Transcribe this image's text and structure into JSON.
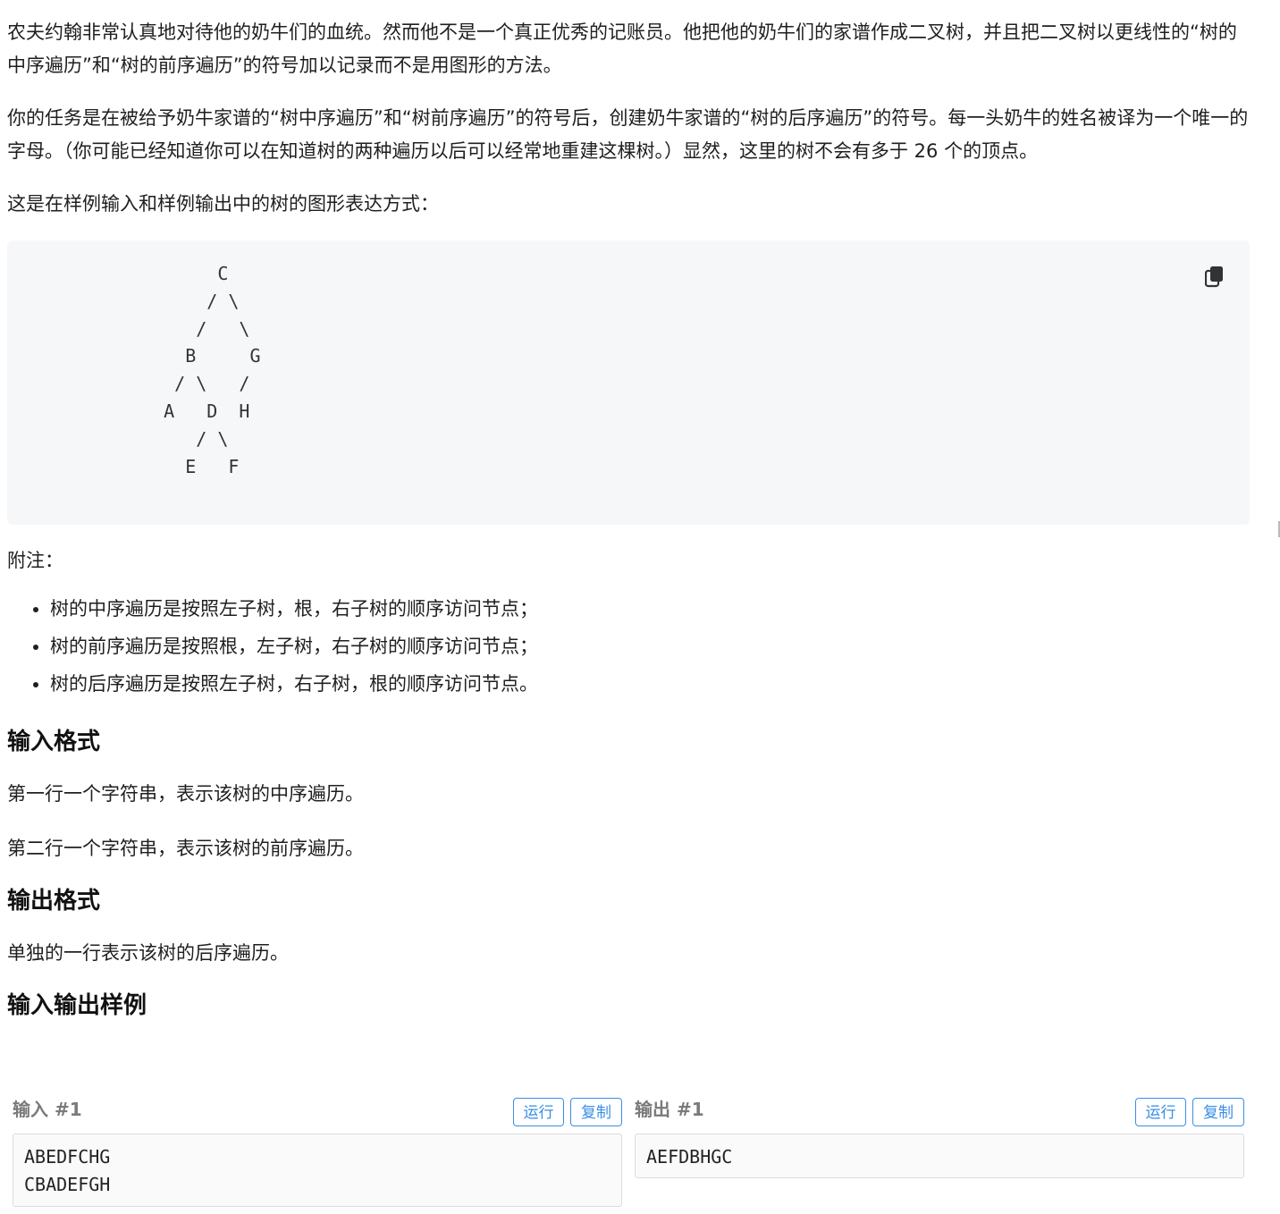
{
  "description": {
    "p1": "农夫约翰非常认真地对待他的奶牛们的血统。然而他不是一个真正优秀的记账员。他把他的奶牛们的家谱作成二叉树，并且把二叉树以更线性的“树的中序遍历”和“树的前序遍历”的符号加以记录而不是用图形的方法。",
    "p2": "你的任务是在被给予奶牛家谱的“树中序遍历”和“树前序遍历”的符号后，创建奶牛家谱的“树的后序遍历”的符号。每一头奶牛的姓名被译为一个唯一的字母。（你可能已经知道你可以在知道树的两种遍历以后可以经常地重建这棵树。）显然，这里的树不会有多于 26 个的顶点。",
    "p3": "这是在样例输入和样例输出中的树的图形表达方式：",
    "tree_code": "        C\n       / \\\n      /   \\\n     B     G\n    / \\   /\n   A   D  H\n      / \\\n     E   F",
    "note_label": "附注：",
    "notes": [
      "树的中序遍历是按照左子树，根，右子树的顺序访问节点；",
      "树的前序遍历是按照根，左子树，右子树的顺序访问节点；",
      "树的后序遍历是按照左子树，右子树，根的顺序访问节点。"
    ]
  },
  "input_format": {
    "heading": "输入格式",
    "line1": "第一行一个字符串，表示该树的中序遍历。",
    "line2": "第二行一个字符串，表示该树的前序遍历。"
  },
  "output_format": {
    "heading": "输出格式",
    "line1": "单独的一行表示该树的后序遍历。"
  },
  "samples": {
    "heading": "输入输出样例",
    "input": {
      "title": "输入 #1",
      "run_label": "运行",
      "copy_label": "复制",
      "content": "ABEDFCHG\nCBADEFGH"
    },
    "output": {
      "title": "输出 #1",
      "run_label": "运行",
      "copy_label": "复制",
      "content": "AEFDBHGC"
    }
  },
  "icons": {
    "copy_code": "copy-icon"
  },
  "colors": {
    "accent": "#3a8ee6",
    "code_bg": "#f6f7f8"
  }
}
